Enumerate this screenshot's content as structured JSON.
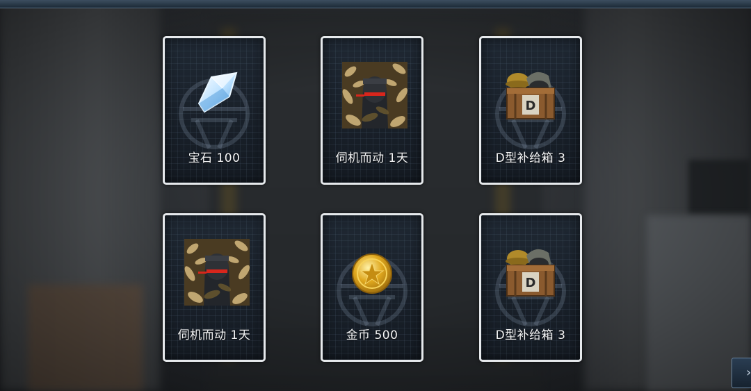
{
  "rewards": [
    {
      "label": "宝石 100",
      "icon": "gem-icon"
    },
    {
      "label": "伺机而动 1天",
      "icon": "portrait-icon"
    },
    {
      "label": "D型补给箱 3",
      "icon": "supply-crate-icon"
    },
    {
      "label": "伺机而动 1天",
      "icon": "portrait-icon"
    },
    {
      "label": "金币 500",
      "icon": "gold-coin-icon"
    },
    {
      "label": "D型补给箱 3",
      "icon": "supply-crate-icon"
    }
  ],
  "crate_letter": "D",
  "next_button": {
    "icon": "chevron-right-icon",
    "glyph": "›"
  },
  "colors": {
    "card_border": "#e6e9ec",
    "card_bg": "#192029",
    "label_text": "#f3f4f5",
    "gold": "#e0a81f",
    "gem": "#bfe3ff"
  }
}
